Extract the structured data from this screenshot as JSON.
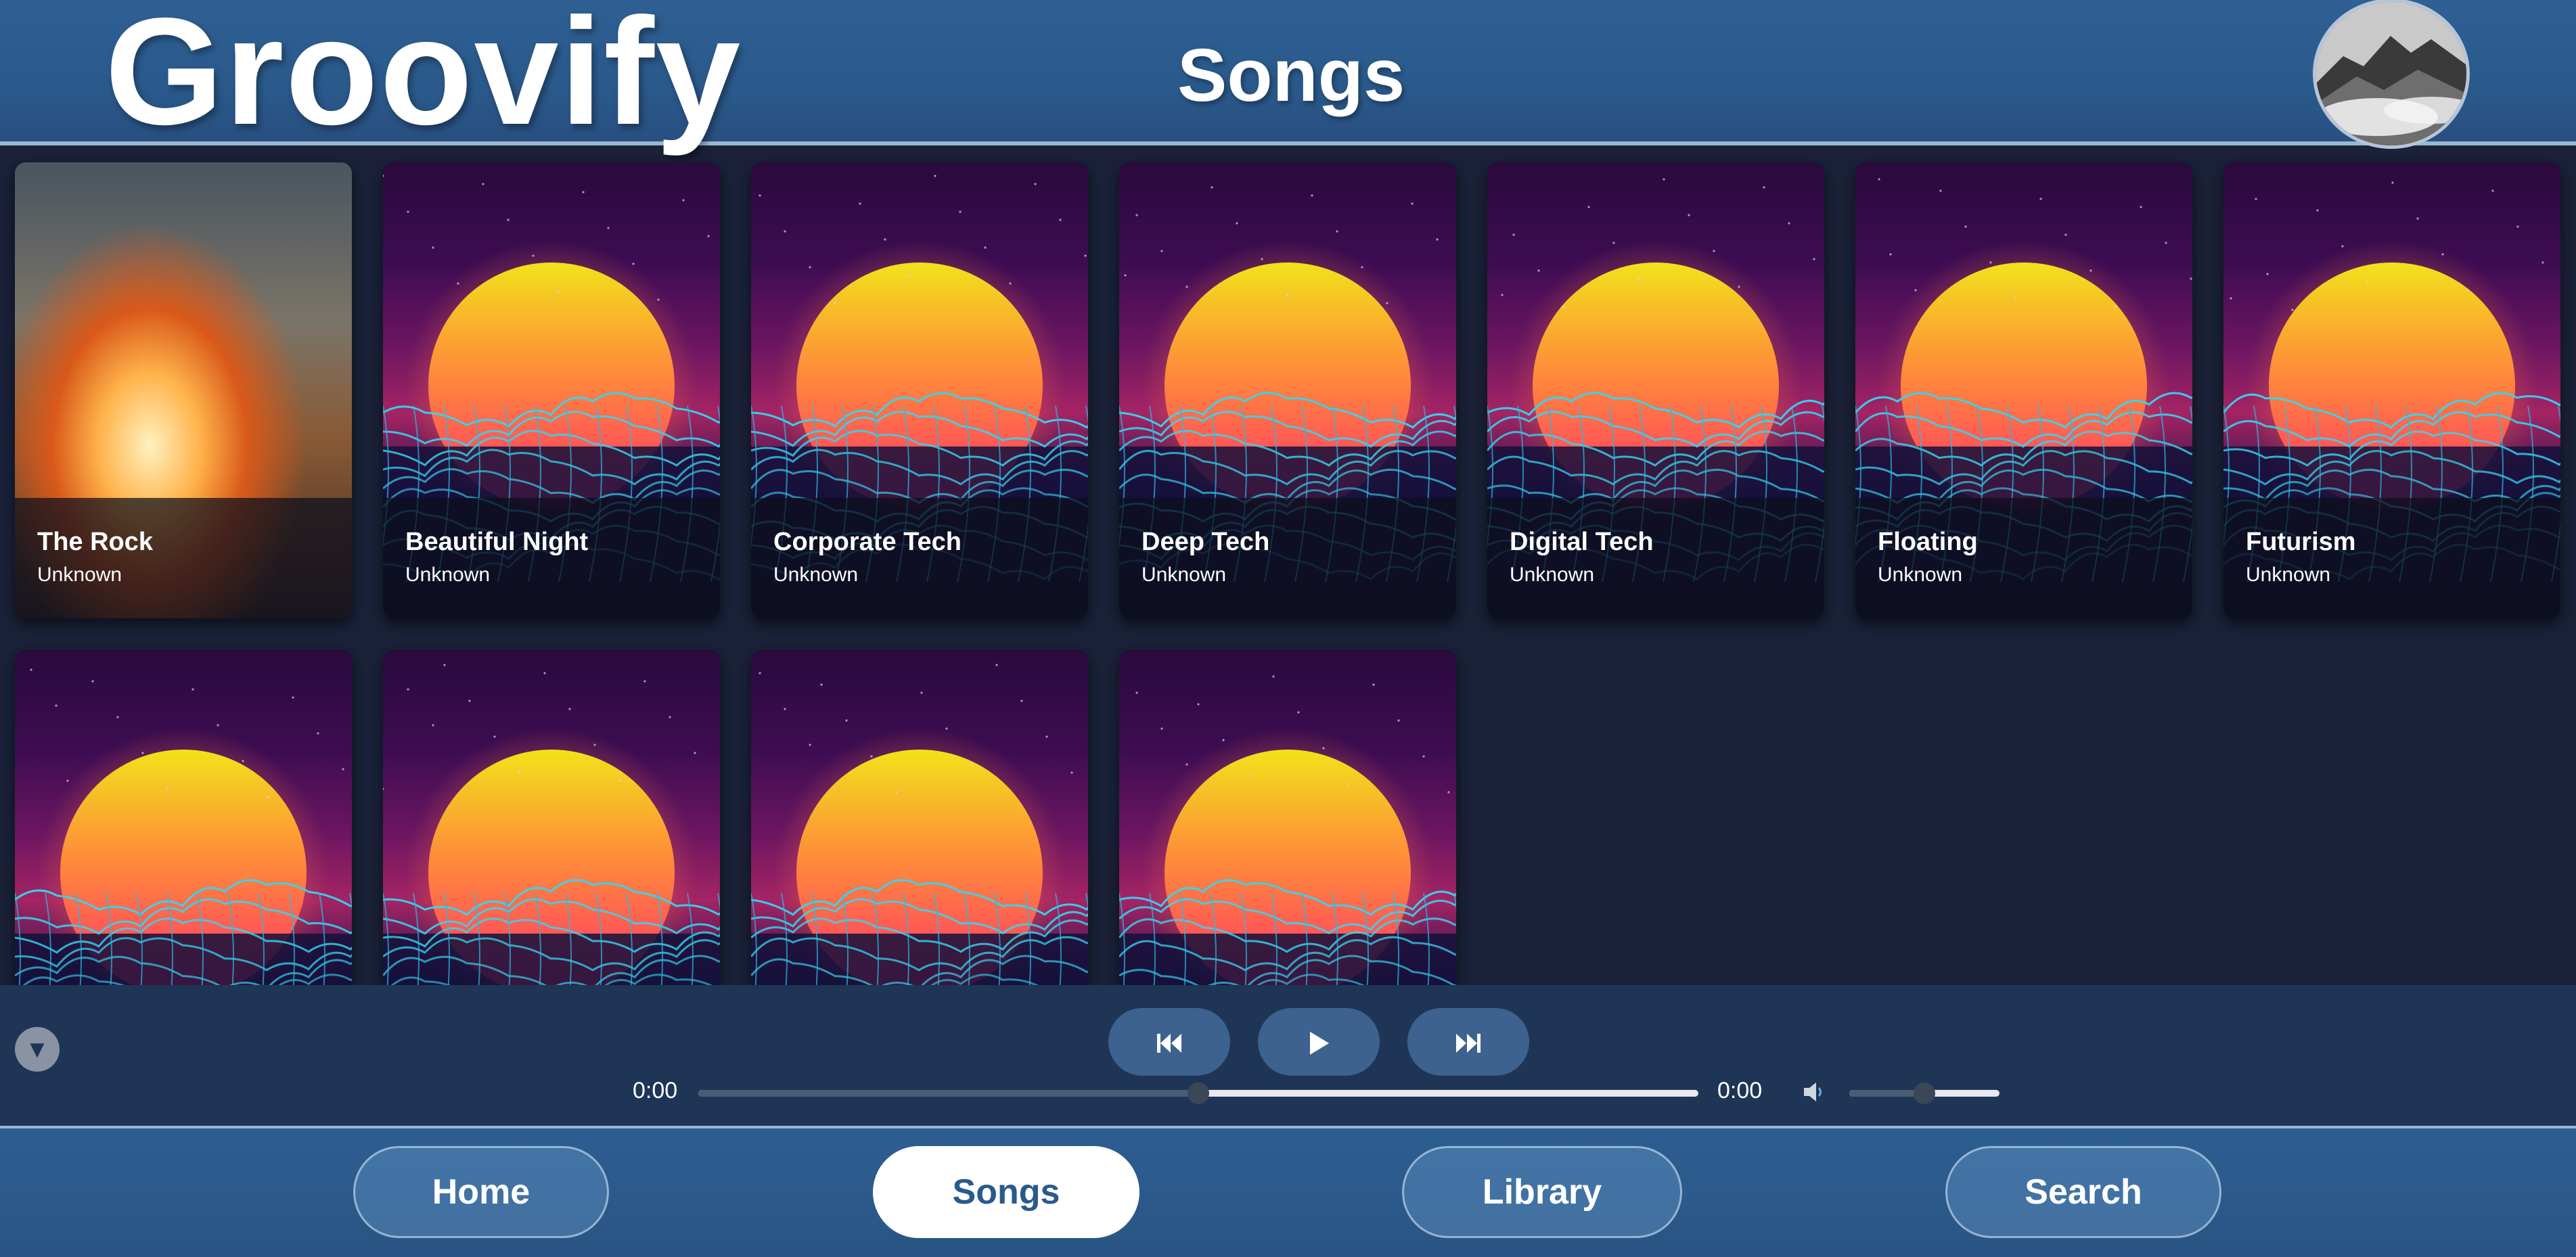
{
  "header": {
    "brand": "Groovify",
    "title": "Songs"
  },
  "songs": [
    {
      "title": "The Rock",
      "artist": "Unknown",
      "art": "rock"
    },
    {
      "title": "Beautiful Night",
      "artist": "Unknown",
      "art": "sunset"
    },
    {
      "title": "Corporate Tech",
      "artist": "Unknown",
      "art": "sunset"
    },
    {
      "title": "Deep Tech",
      "artist": "Unknown",
      "art": "sunset"
    },
    {
      "title": "Digital Tech",
      "artist": "Unknown",
      "art": "sunset"
    },
    {
      "title": "Floating",
      "artist": "Unknown",
      "art": "sunset"
    },
    {
      "title": "Futurism",
      "artist": "Unknown",
      "art": "sunset"
    },
    {
      "art": "sunset"
    },
    {
      "art": "sunset"
    },
    {
      "art": "sunset"
    },
    {
      "art": "sunset"
    }
  ],
  "player": {
    "current_time": "0:00",
    "duration": "0:00",
    "seek_level": 0.5,
    "volume_level": 0.5,
    "collapse_icon": "triangle-down-icon",
    "prev_icon": "skip-previous-icon",
    "play_icon": "play-icon",
    "next_icon": "skip-next-icon",
    "volume_icon": "speaker-icon"
  },
  "nav": {
    "items": [
      {
        "label": "Home",
        "active": false
      },
      {
        "label": "Songs",
        "active": true
      },
      {
        "label": "Library",
        "active": false
      },
      {
        "label": "Search",
        "active": false
      }
    ]
  },
  "colors": {
    "header": "#2a5a8c",
    "background": "#1a2138",
    "player": "#1f3556",
    "control": "#3d628f"
  }
}
